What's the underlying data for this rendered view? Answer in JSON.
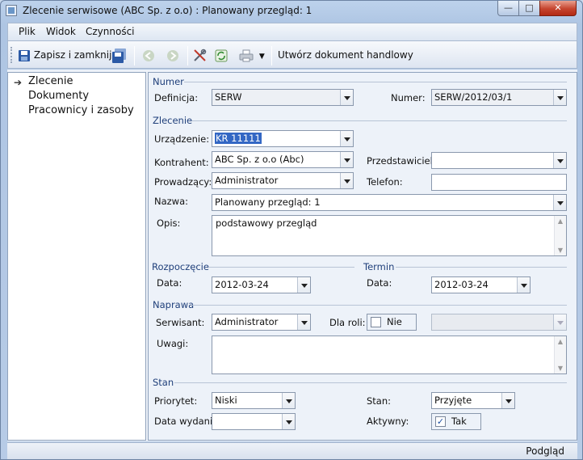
{
  "window": {
    "title": "Zlecenie serwisowe (ABC Sp. z o.o) : Planowany przegląd: 1",
    "min": "—",
    "max": "□",
    "close": "✕"
  },
  "menu": {
    "items": [
      "Plik",
      "Widok",
      "Czynności"
    ]
  },
  "toolbar": {
    "save_close": "Zapisz i zamknij",
    "commercial_doc": "Utwórz dokument handlowy"
  },
  "nav": {
    "items": [
      "Zlecenie",
      "Dokumenty",
      "Pracownicy i zasoby"
    ],
    "arrow": "➔"
  },
  "form": {
    "numer": {
      "group": "Numer",
      "definicja_label": "Definicja:",
      "definicja_value": "SERW",
      "numer_label": "Numer:",
      "numer_value": "SERW/2012/03/1"
    },
    "zlecenie": {
      "group": "Zlecenie",
      "urzadzenie_label": "Urządzenie:",
      "urzadzenie_value": "KR 11111",
      "kontrahent_label": "Kontrahent:",
      "kontrahent_value": "ABC Sp. z o.o (Abc)",
      "przedstawiciel_label": "Przedstawiciel:",
      "przedstawiciel_value": "",
      "prowadzacy_label": "Prowadzący:",
      "prowadzacy_value": "Administrator",
      "telefon_label": "Telefon:",
      "telefon_value": "",
      "nazwa_label": "Nazwa:",
      "nazwa_value": "Planowany przegląd: 1",
      "opis_label": "Opis:",
      "opis_value": "podstawowy przegląd"
    },
    "rozpoczecie": {
      "group": "Rozpoczęcie",
      "data_label": "Data:",
      "data_value": "2012-03-24"
    },
    "termin": {
      "group": "Termin",
      "data_label": "Data:",
      "data_value": "2012-03-24"
    },
    "naprawa": {
      "group": "Naprawa",
      "serwisant_label": "Serwisant:",
      "serwisant_value": "Administrator",
      "dla_roli_label": "Dla roli:",
      "dla_roli_value": "Nie",
      "uwagi_label": "Uwagi:",
      "uwagi_value": ""
    },
    "stan": {
      "group": "Stan",
      "priorytet_label": "Priorytet:",
      "priorytet_value": "Niski",
      "stan_label": "Stan:",
      "stan_value": "Przyjęte",
      "data_wydania_label": "Data wydania:",
      "data_wydania_value": "",
      "aktywny_label": "Aktywny:",
      "aktywny_value": "Tak"
    }
  },
  "status": {
    "text": "Podgląd"
  },
  "colors": {
    "accent": "#1f3f7a",
    "selection": "#3367c4",
    "close": "#c5442e"
  }
}
